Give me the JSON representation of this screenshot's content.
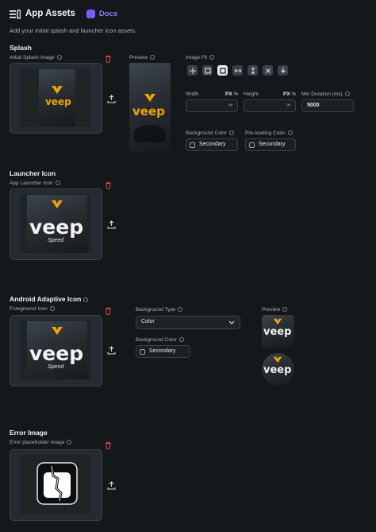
{
  "header": {
    "title": "App Assets",
    "docs_label": "Docs",
    "subtitle": "Add your initial splash and launcher icon assets."
  },
  "splash": {
    "section_title": "Splash",
    "initial_label": "Initial Splash Image",
    "preview_label": "Preview",
    "image_fit_label": "Image Fit",
    "fit_options": [
      "contain-icon",
      "fill-icon",
      "cover-icon",
      "fit-width-icon",
      "fit-height-icon",
      "none-icon",
      "scale-down-icon"
    ],
    "width_label": "Width",
    "height_label": "Height",
    "unit_px": "PX",
    "unit_pct": "%",
    "width_value": "∞",
    "height_value": "∞",
    "min_duration_label": "Min Duration (ms)",
    "min_duration_value": "5000",
    "bg_color_label": "Background Color",
    "bg_color_value": "Secondary",
    "preloading_label": "Pre-loading Color",
    "preloading_value": "Secondary"
  },
  "launcher": {
    "section_title": "Launcher Icon",
    "app_icon_label": "App Launcher Icon"
  },
  "android": {
    "section_title": "Android Adaptive Icon",
    "foreground_label": "Foreground Icon",
    "bg_type_label": "Background Type",
    "bg_type_value": "Color",
    "bg_color_label": "Background Color",
    "bg_color_value": "Secondary",
    "preview_label": "Preview"
  },
  "error": {
    "section_title": "Error Image",
    "placeholder_label": "Error placeholder image"
  },
  "brand": {
    "logo_text": "veep",
    "logo_sub": "Speed",
    "logo_small": "veep"
  },
  "colors": {
    "accent": "#8b7bff",
    "danger": "#e0454a",
    "logo_orange": "#f4a300"
  }
}
